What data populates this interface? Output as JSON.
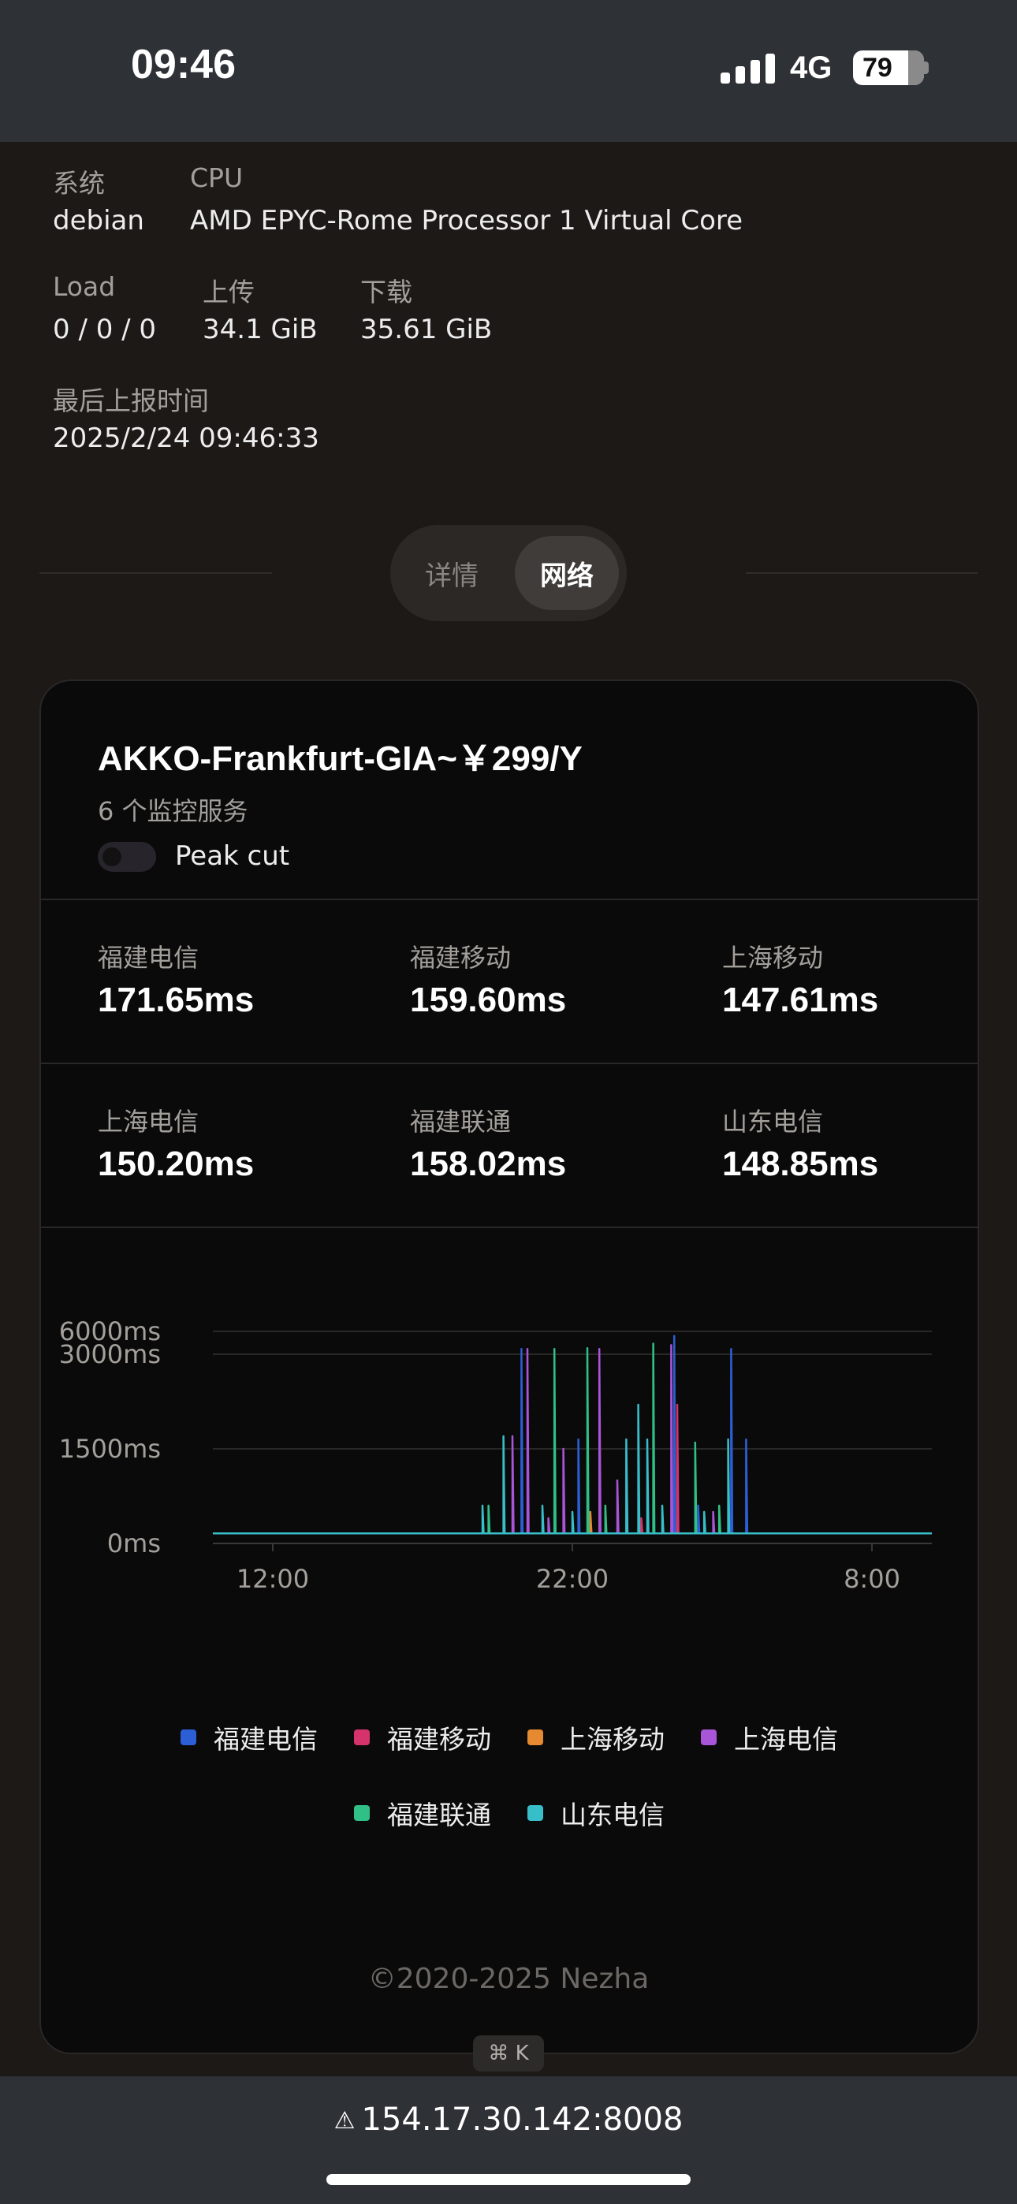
{
  "status": {
    "time": "09:46",
    "network": "4G",
    "battery": "79"
  },
  "info": {
    "system_label": "系统",
    "system_value": "debian",
    "cpu_label": "CPU",
    "cpu_value": "AMD EPYC-Rome Processor 1 Virtual Core",
    "load_label": "Load",
    "load_value": "0 / 0 / 0",
    "upload_label": "上传",
    "upload_value": "34.1 GiB",
    "download_label": "下载",
    "download_value": "35.61 GiB",
    "last_report_label": "最后上报时间",
    "last_report_value": "2025/2/24 09:46:33"
  },
  "tabs": [
    {
      "label": "详情",
      "active": false
    },
    {
      "label": "网络",
      "active": true
    }
  ],
  "card": {
    "server_name": "AKKO-Frankfurt-GIA~￥299/Y",
    "monitor_count": "6 个监控服务",
    "peak_cut_label": "Peak cut",
    "peak_cut_enabled": false,
    "stats": [
      {
        "label": "福建电信",
        "value": "171.65ms"
      },
      {
        "label": "福建移动",
        "value": "159.60ms"
      },
      {
        "label": "上海移动",
        "value": "147.61ms"
      },
      {
        "label": "上海电信",
        "value": "150.20ms"
      },
      {
        "label": "福建联通",
        "value": "158.02ms"
      },
      {
        "label": "山东电信",
        "value": "148.85ms"
      }
    ]
  },
  "chart_data": {
    "type": "line",
    "y_tick_labels": [
      "6000ms",
      "3000ms",
      "1500ms",
      "0ms"
    ],
    "y_ticks": [
      6000,
      3000,
      1500,
      0
    ],
    "ylim": [
      0,
      6000
    ],
    "x_tick_labels": [
      "12:00",
      "22:00",
      "8:00"
    ],
    "x_ticks": [
      2,
      12,
      22
    ],
    "xlim": [
      0,
      24
    ],
    "baseline_ms": 160,
    "grid": true,
    "legend_position": "bottom",
    "series": [
      {
        "name": "福建电信",
        "color": "#2c5fd6",
        "spikes": [
          [
            10.3,
            3700
          ],
          [
            12.2,
            1650
          ],
          [
            13.8,
            1500
          ],
          [
            15.4,
            5400
          ],
          [
            16.2,
            600
          ],
          [
            17.3,
            3700
          ],
          [
            17.8,
            1650
          ]
        ]
      },
      {
        "name": "福建移动",
        "color": "#d6336c",
        "spikes": [
          [
            14.3,
            400
          ],
          [
            15.5,
            2200
          ]
        ]
      },
      {
        "name": "上海移动",
        "color": "#e58a30",
        "spikes": [
          [
            12.6,
            500
          ]
        ]
      },
      {
        "name": "上海电信",
        "color": "#a855d8",
        "spikes": [
          [
            10.0,
            1700
          ],
          [
            10.5,
            3700
          ],
          [
            11.2,
            400
          ],
          [
            11.7,
            1500
          ],
          [
            12.9,
            3700
          ],
          [
            13.5,
            1000
          ],
          [
            15.3,
            4200
          ],
          [
            16.7,
            500
          ]
        ]
      },
      {
        "name": "福建联通",
        "color": "#2fbf87",
        "spikes": [
          [
            9.2,
            600
          ],
          [
            11.4,
            3700
          ],
          [
            12.5,
            3800
          ],
          [
            13.1,
            600
          ],
          [
            14.7,
            4400
          ],
          [
            16.1,
            1600
          ],
          [
            16.9,
            600
          ]
        ]
      },
      {
        "name": "山东电信",
        "color": "#38bec9",
        "spikes": [
          [
            9.0,
            600
          ],
          [
            9.7,
            1700
          ],
          [
            11.0,
            600
          ],
          [
            12.0,
            500
          ],
          [
            13.8,
            1650
          ],
          [
            14.2,
            2200
          ],
          [
            14.5,
            1650
          ],
          [
            15.0,
            600
          ],
          [
            16.4,
            500
          ],
          [
            17.2,
            1650
          ]
        ]
      }
    ]
  },
  "footer": {
    "copyright": "©2020-2025 Nezha",
    "shortcut": "⌘ K"
  },
  "browser": {
    "url": "154.17.30.142:8008"
  }
}
